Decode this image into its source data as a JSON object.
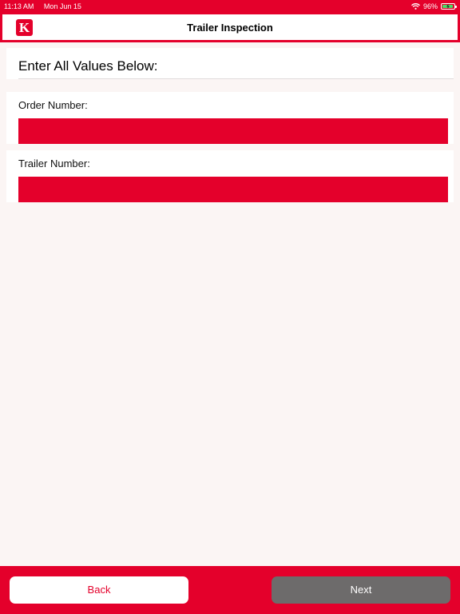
{
  "status_bar": {
    "time": "11:13 AM",
    "date": "Mon Jun 15",
    "wifi_icon": "wifi-icon",
    "battery_percent": "96%",
    "battery_level": 0.96,
    "charging_icon": "bolt-icon"
  },
  "nav": {
    "logo_letter": "K",
    "title": "Trailer Inspection"
  },
  "form": {
    "heading": "Enter All Values Below:",
    "fields": [
      {
        "label": "Order Number:",
        "value": "",
        "placeholder": ""
      },
      {
        "label": "Trailer Number:",
        "value": "",
        "placeholder": ""
      }
    ]
  },
  "footer": {
    "back_label": "Back",
    "next_label": "Next"
  },
  "colors": {
    "brand_red": "#e4002b",
    "background": "#fbf5f4",
    "next_button": "#6d6b6b"
  }
}
